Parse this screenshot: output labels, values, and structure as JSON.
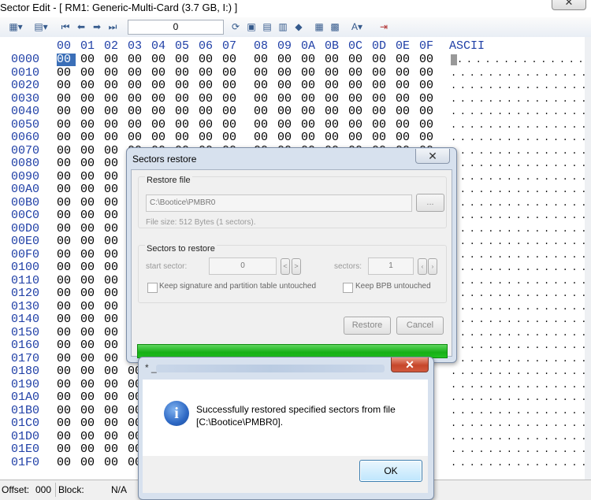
{
  "window": {
    "title": "Sector Edit - [ RM1: Generic-Multi-Card (3.7 GB, I:) ]",
    "close_glyph": "✕"
  },
  "toolbar": {
    "sector_value": "0"
  },
  "hex": {
    "columns": [
      "00",
      "01",
      "02",
      "03",
      "04",
      "05",
      "06",
      "07",
      "08",
      "09",
      "0A",
      "0B",
      "0C",
      "0D",
      "0E",
      "0F"
    ],
    "ascii_header": "ASCII",
    "offsets": [
      "0000",
      "0010",
      "0020",
      "0030",
      "0040",
      "0050",
      "0060",
      "0070",
      "0080",
      "0090",
      "00A0",
      "00B0",
      "00C0",
      "00D0",
      "00E0",
      "00F0",
      "0100",
      "0110",
      "0120",
      "0130",
      "0140",
      "0150",
      "0160",
      "0170",
      "0180",
      "0190",
      "01A0",
      "01B0",
      "01C0",
      "01D0",
      "01E0",
      "01F0"
    ],
    "byte": "00",
    "ascii_row": "................"
  },
  "status": {
    "offset_label": "Offset:",
    "offset_value": "000",
    "block_label": "Block:",
    "block_value": "N/A"
  },
  "sectors_restore": {
    "title": "Sectors restore",
    "restore_file_label": "Restore file",
    "file_path": "C:\\Bootice\\PMBR0",
    "browse_label": "...",
    "file_size": "File size: 512 Bytes (1 sectors).",
    "sectors_group_label": "Sectors to restore",
    "start_sector_label": "start sector:",
    "start_sector_value": "0",
    "sectors_label": "sectors:",
    "sectors_value": "1",
    "keep_sig_label": "Keep signature and partition table untouched",
    "keep_bpb_label": "Keep BPB untouched",
    "restore_button": "Restore",
    "cancel_button": "Cancel",
    "close_glyph": "✕",
    "progress": 1.0
  },
  "message_box": {
    "title": "* _",
    "message_line1": "Successfully restored specified sectors from file",
    "message_line2": "[C:\\Bootice\\PMBR0].",
    "ok_button": "OK",
    "close_glyph": "✕",
    "icon": "info-icon"
  }
}
